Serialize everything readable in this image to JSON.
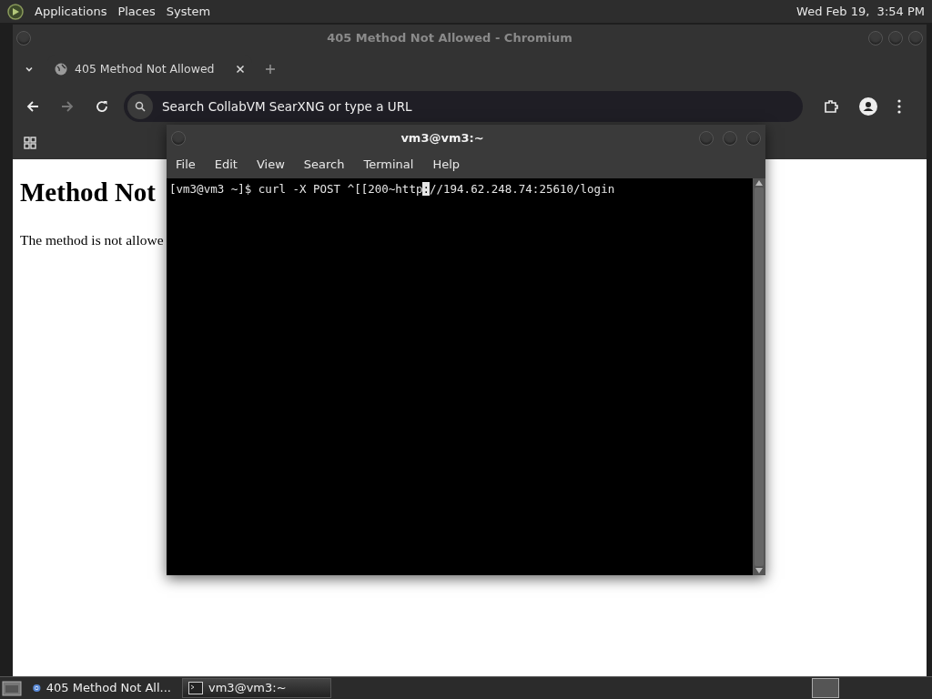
{
  "top_panel": {
    "menus": [
      "Applications",
      "Places",
      "System"
    ],
    "clock": "Wed Feb 19,  3:54 PM"
  },
  "browser": {
    "title": "405 Method Not Allowed - Chromium",
    "tabs": [
      {
        "label": "405 Method Not Allowed",
        "selected": true
      }
    ],
    "omnibox": {
      "placeholder": "Search CollabVM SearXNG or type a URL"
    },
    "page": {
      "heading": "Method Not",
      "paragraph": "The method is not allowe"
    }
  },
  "terminal": {
    "title": "vm3@vm3:~",
    "menus": [
      "File",
      "Edit",
      "View",
      "Search",
      "Terminal",
      "Help"
    ],
    "line": {
      "before_cursor": "[vm3@vm3 ~]$ curl -X POST ^[[200~http",
      "at_cursor": ":",
      "after_cursor": "//194.62.248.74:25610/login"
    }
  },
  "taskbar": {
    "items": [
      {
        "kind": "browser",
        "label": "405 Method Not All...",
        "selected": false
      },
      {
        "kind": "terminal",
        "label": "vm3@vm3:~",
        "selected": true
      }
    ]
  }
}
